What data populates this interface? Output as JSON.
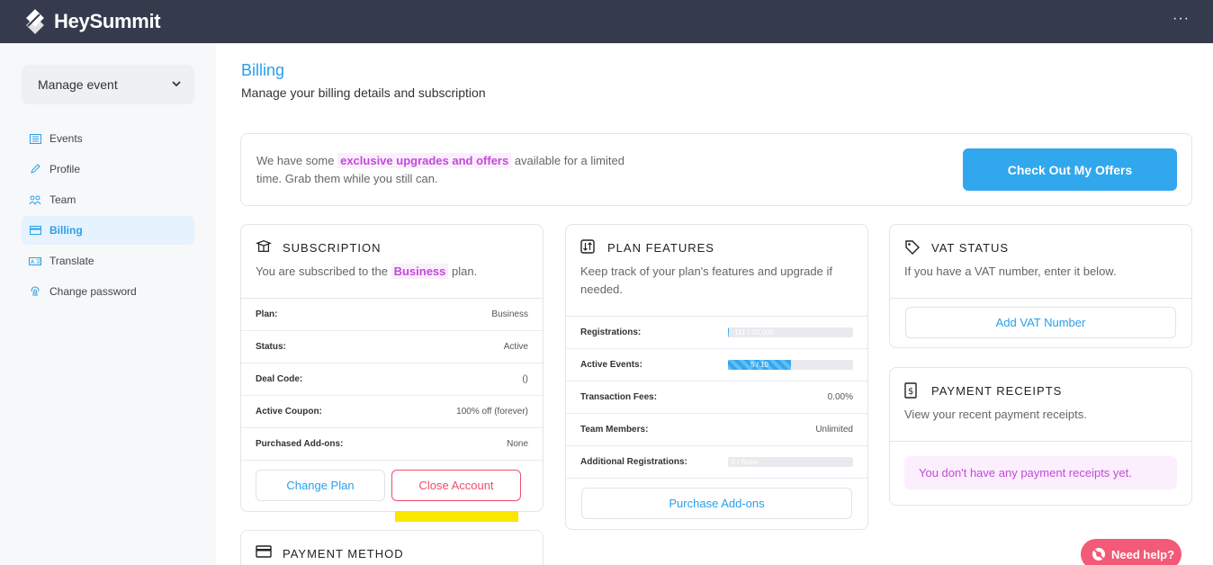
{
  "app": {
    "name": "HeySummit"
  },
  "sidebar": {
    "manage_label": "Manage event",
    "items": [
      {
        "label": "Events",
        "icon": "calendar-icon"
      },
      {
        "label": "Profile",
        "icon": "pencil-icon"
      },
      {
        "label": "Team",
        "icon": "team-icon"
      },
      {
        "label": "Billing",
        "icon": "credit-card-icon"
      },
      {
        "label": "Translate",
        "icon": "translate-icon"
      },
      {
        "label": "Change password",
        "icon": "fingerprint-icon"
      }
    ],
    "active_item": "Billing"
  },
  "page": {
    "title": "Billing",
    "subtitle": "Manage your billing details and subscription"
  },
  "offer": {
    "text_before": "We have some ",
    "highlight": "exclusive upgrades and offers",
    "text_after": " available for a limited time. Grab them while you still can.",
    "button": "Check Out My Offers"
  },
  "subscription": {
    "title": "SUBSCRIPTION",
    "desc_before": "You are subscribed to the ",
    "plan_highlight": "Business",
    "desc_after": " plan.",
    "rows": [
      {
        "k": "Plan:",
        "v": "Business"
      },
      {
        "k": "Status:",
        "v": "Active"
      },
      {
        "k": "Deal Code:",
        "v": "()"
      },
      {
        "k": "Active Coupon:",
        "v": "100% off (forever)"
      },
      {
        "k": "Purchased Add-ons:",
        "v": "None"
      }
    ],
    "change_plan": "Change Plan",
    "close_account": "Close Account"
  },
  "plan_features": {
    "title": "PLAN FEATURES",
    "desc": "Keep track of your plan's features and upgrade if needed.",
    "registrations": {
      "k": "Registrations:",
      "label": "111 / 20,000",
      "fraction": 0.0056
    },
    "active_events": {
      "k": "Active Events:",
      "label": "5 / 10",
      "fraction": 0.5
    },
    "transaction_fees": {
      "k": "Transaction Fees:",
      "v": "0.00%"
    },
    "team_members": {
      "k": "Team Members:",
      "v": "Unlimited"
    },
    "additional_registrations": {
      "k": "Additional Registrations:",
      "label": "0 / None",
      "fraction": 0
    },
    "purchase_addons": "Purchase Add-ons"
  },
  "vat": {
    "title": "VAT STATUS",
    "desc": "If you have a VAT number, enter it below.",
    "button": "Add VAT Number"
  },
  "receipts": {
    "title": "PAYMENT RECEIPTS",
    "desc": "View your recent payment receipts.",
    "empty": "You don't have any payment receipts yet."
  },
  "payment_method": {
    "title": "PAYMENT METHOD"
  },
  "help": {
    "label": "Need help?"
  },
  "colors": {
    "accent": "#31a7ee",
    "topbar": "#353b4d",
    "danger": "#f04d6a",
    "highlight": "#c24ad9",
    "help": "#f25a78"
  }
}
